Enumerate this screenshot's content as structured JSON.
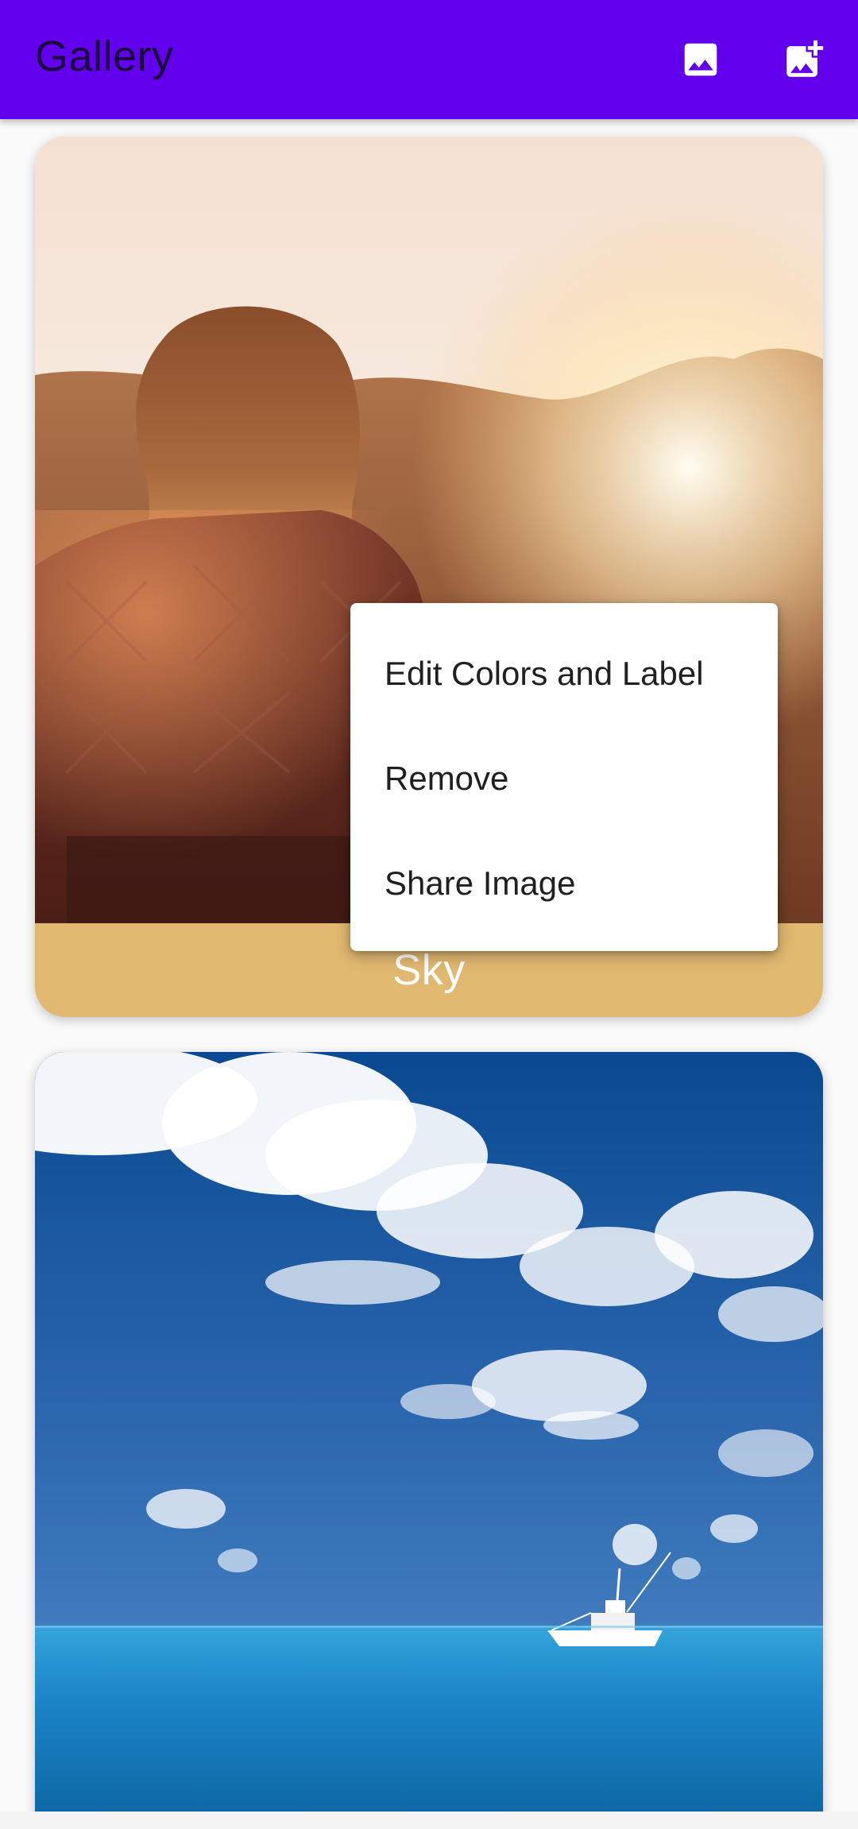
{
  "app_bar": {
    "title": "Gallery",
    "background_color": "#6200ee",
    "actions": [
      {
        "icon": "image-icon",
        "label": "Gallery"
      },
      {
        "icon": "add-photo-icon",
        "label": "Add image"
      }
    ]
  },
  "cards": [
    {
      "image": "woman-in-sunset",
      "label": "Sky",
      "label_background": "#e0b870"
    },
    {
      "image": "blue-sky-sea-boat",
      "label": ""
    }
  ],
  "popup_menu": {
    "items": [
      "Edit Colors and Label",
      "Remove",
      "Share Image"
    ]
  }
}
